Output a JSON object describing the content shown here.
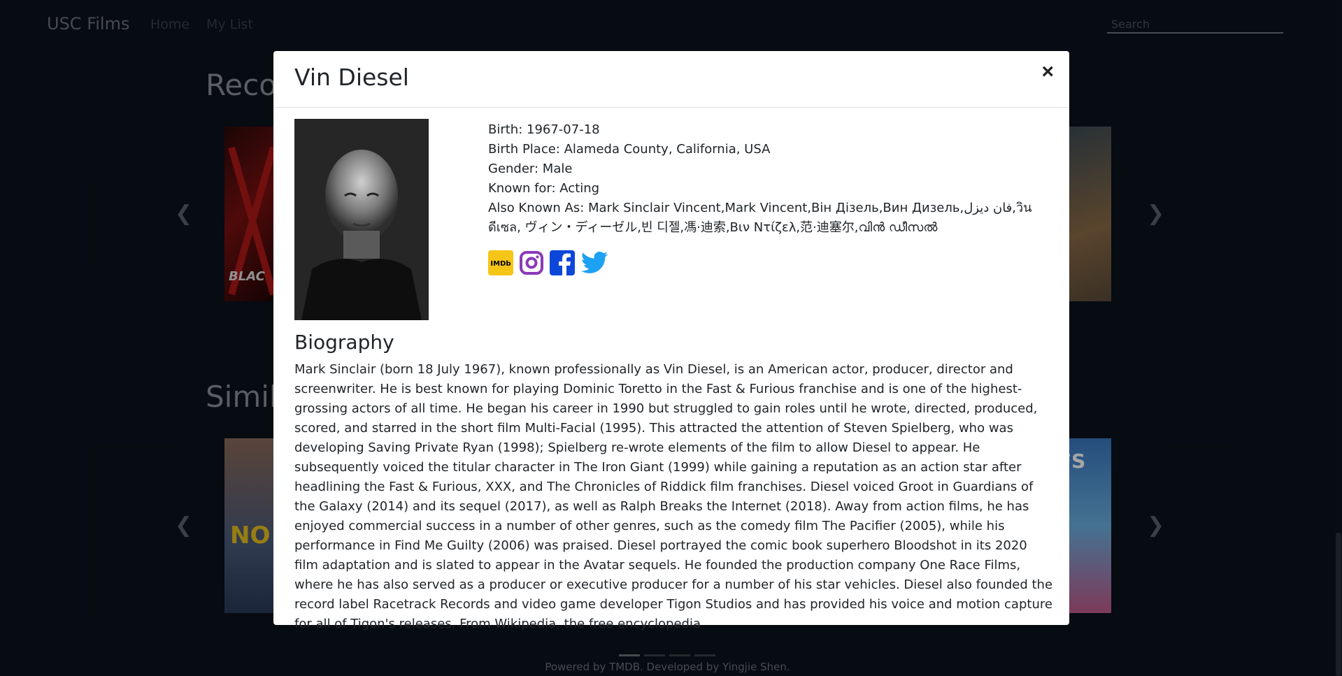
{
  "navbar": {
    "brand": "USC Films",
    "links": [
      "Home",
      "My List"
    ],
    "search_placeholder": "Search"
  },
  "sections": {
    "recommended_title": "Recom",
    "similar_title": "Simila"
  },
  "footer": "Powered by TMDB. Developed by Yingjie Shen.",
  "modal": {
    "name": "Vin Diesel",
    "close_label": "×",
    "birth": "Birth: 1967-07-18",
    "birth_place": "Birth Place: Alameda County, California, USA",
    "gender": "Gender: Male",
    "known_for": "Known for: Acting",
    "also_known_as": "Also Known As: Mark Sinclair Vincent,Mark Vincent,Він Дізель,Вин Дизель,فان ديزل,วิน ดีเซล, ヴィン・ディーゼル,빈 디젤,馮·迪索,Βιν Ντίζελ,范·迪塞尔,വിൻ ഡീസൽ",
    "social": [
      "imdb-icon",
      "instagram-icon",
      "facebook-icon",
      "twitter-icon"
    ],
    "bio_title": "Biography",
    "bio": "Mark Sinclair (born 18 July 1967), known professionally as Vin Diesel, is an American actor, producer, director and screenwriter. He is best known for playing Dominic Toretto in the Fast & Furious franchise and is one of the highest-grossing actors of all time. He began his career in 1990 but struggled to gain roles until he wrote, directed, produced, scored, and starred in the short film Multi-Facial (1995). This attracted the attention of Steven Spielberg, who was developing Saving Private Ryan (1998); Spielberg re-wrote elements of the film to allow Diesel to appear. He subsequently voiced the titular character in The Iron Giant (1999) while gaining a reputation as an action star after headlining the Fast & Furious, XXX, and The Chronicles of Riddick film franchises. Diesel voiced Groot in Guardians of the Galaxy (2014) and its sequel (2017), as well as Ralph Breaks the Internet (2018). Away from action films, he has enjoyed commercial success in a number of other genres, such as the comedy film The Pacifier (2005), while his performance in Find Me Guilty (2006) was praised. Diesel portrayed the comic book superhero Bloodshot in its 2020 film adaptation and is slated to appear in the Avatar sequels. He founded the production company One Race Films, where he has also served as a producer or executive producer for a number of his star vehicles. Diesel also founded the record label Racetrack Records and video game developer Tigon Studios and has provided his voice and motion capture for all of Tigon's releases. From Wikipedia, the free encyclopedia"
  },
  "colors": {
    "page_bg": "#0b111d",
    "imdb": "#f5c518",
    "instagram": "#8a3ab9",
    "facebook": "#0d47d9",
    "twitter": "#1da1f2"
  }
}
